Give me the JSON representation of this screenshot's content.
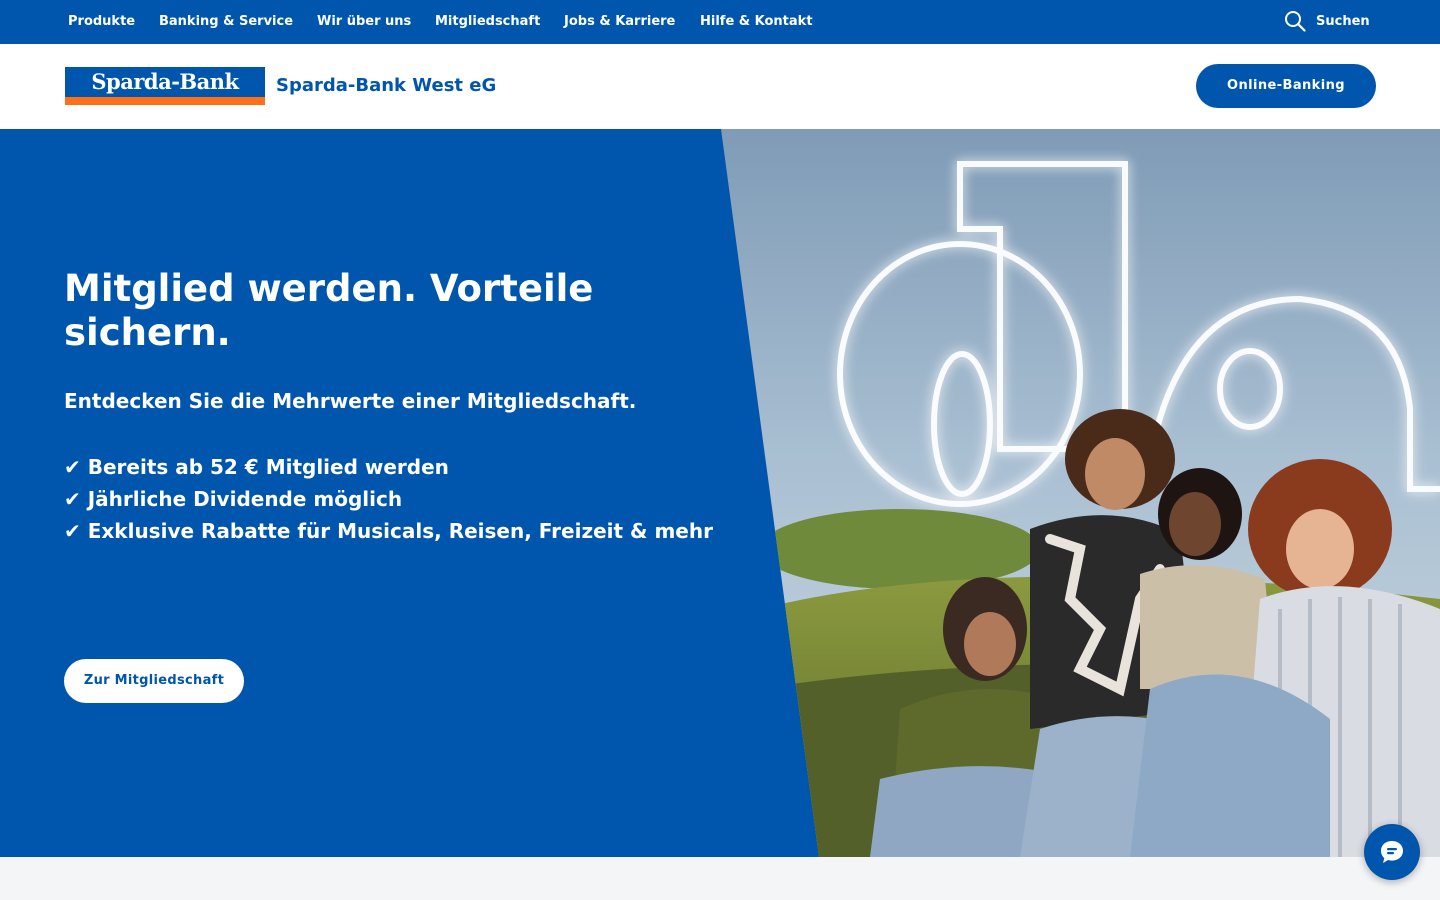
{
  "topnav": {
    "items": [
      {
        "label": "Produkte"
      },
      {
        "label": "Banking & Service"
      },
      {
        "label": "Wir über uns"
      },
      {
        "label": "Mitgliedschaft"
      },
      {
        "label": "Jobs & Karriere"
      },
      {
        "label": "Hilfe & Kontakt"
      }
    ],
    "search_label": "Suchen",
    "search_icon": "search-icon"
  },
  "header": {
    "logo_text": "Sparda-Bank",
    "bank_name": "Sparda-Bank West eG",
    "online_banking_label": "Online-Banking"
  },
  "hero": {
    "title": "Mitglied werden. Vorteile sichern.",
    "subtitle": "Entdecken Sie die Mehrwerte einer Mitgliedschaft.",
    "benefits": [
      "✔ Bereits ab 52 € Mitglied werden",
      "✔ Jährliche Dividende möglich",
      "✔ Exklusive Rabatte für Musicals, Reisen, Freizeit & mehr"
    ],
    "cta_label": "Zur Mitgliedschaft",
    "image_neon_text": "da"
  },
  "chat": {
    "icon": "chat-icon"
  },
  "colors": {
    "brand_blue": "#0056ac",
    "brand_orange": "#ff6e19",
    "white": "#ffffff",
    "page_background": "#f4f5f7"
  }
}
